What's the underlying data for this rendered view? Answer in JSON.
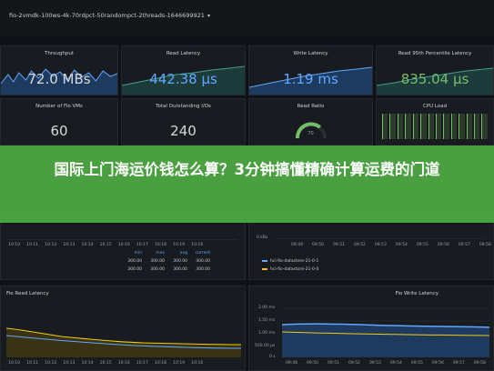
{
  "header": {
    "title": "fio-2vmdk-100ws-4k-70rdpct-50randompct-2threads-1646699921"
  },
  "stats": [
    {
      "title": "Throughput",
      "value": "72.0 MBs"
    },
    {
      "title": "Read Latency",
      "value": "442.38 µs"
    },
    {
      "title": "Write Latency",
      "value": "1.19 ms"
    },
    {
      "title": "Read 95th Percentile Latency",
      "value": "835.04 µs"
    },
    {
      "title": "Number of Fio VMs",
      "value": "60"
    },
    {
      "title": "Total Outstanding I/Os",
      "value": "240"
    },
    {
      "title": "Read Ratio",
      "value": "70"
    },
    {
      "title": "CPU Load",
      "value": ""
    }
  ],
  "banner": {
    "text": "国际上门海运价钱怎么算？3分钟搞懂精确计算运费的门道"
  },
  "mid": {
    "left_times": [
      "10:10",
      "10:11",
      "10:12",
      "10:13",
      "10:14",
      "10:15",
      "10:16",
      "10:17",
      "10:18",
      "10:19",
      "10:16"
    ],
    "left_table_headers": [
      "min",
      "max",
      "avg",
      "current"
    ],
    "left_table_rows": [
      [
        "300.00",
        "300.00",
        "300.00",
        "300.00"
      ],
      [
        "300.00",
        "300.00",
        "300.00",
        "300.00"
      ]
    ],
    "right_y": "0 kBs",
    "right_times": [
      "09:49",
      "09:50",
      "09:51",
      "09:52",
      "09:53",
      "09:54",
      "09:55",
      "09:56",
      "09:57",
      "09:58"
    ],
    "right_legend": [
      "hci-fio-datastore-21-0-1",
      "hci-fio-datastore-21-0-0"
    ]
  },
  "bottom": {
    "left_title": "Fio Read Latency",
    "right_title": "Fio Write Latency",
    "right_y": [
      "2.00 ms",
      "1.50 ms",
      "1.00 ms",
      "500.00 µs",
      "0 s"
    ],
    "left_times": [
      "10:10",
      "10:11",
      "10:12",
      "10:13",
      "10:14",
      "10:15",
      "10:16",
      "10:17",
      "10:18",
      "10:19",
      "10:16"
    ],
    "right_times": [
      "09:48",
      "09:50",
      "09:51",
      "09:52",
      "09:53",
      "09:54",
      "09:55",
      "09:56",
      "09:57",
      "09:58"
    ]
  }
}
